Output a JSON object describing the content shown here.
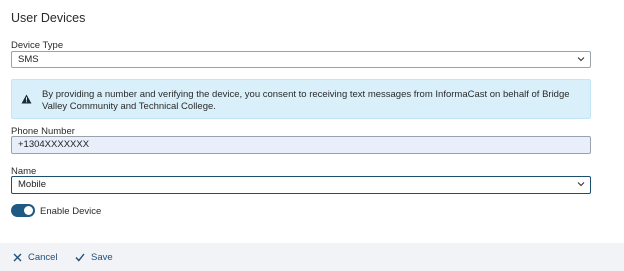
{
  "page": {
    "title": "User Devices"
  },
  "device_type": {
    "label": "Device Type",
    "value": "SMS",
    "icon": "chevron-down-icon"
  },
  "banner": {
    "icon": "warning-icon",
    "message": "By providing a number and verifying the device, you consent to receiving text messages from InformaCast on behalf of Bridge Valley Community and Technical College."
  },
  "phone": {
    "label": "Phone Number",
    "value": "+1304XXXXXXX"
  },
  "name": {
    "label": "Name",
    "value": "Mobile",
    "icon": "chevron-down-icon"
  },
  "enable": {
    "label": "Enable Device",
    "enabled": true
  },
  "footer": {
    "cancel_label": "Cancel",
    "cancel_icon": "close-icon",
    "save_label": "Save",
    "save_icon": "check-icon"
  },
  "colors": {
    "accent": "#1f5a84",
    "banner_bg": "#d9f0fb",
    "footer_bg": "#f1f3f6"
  }
}
